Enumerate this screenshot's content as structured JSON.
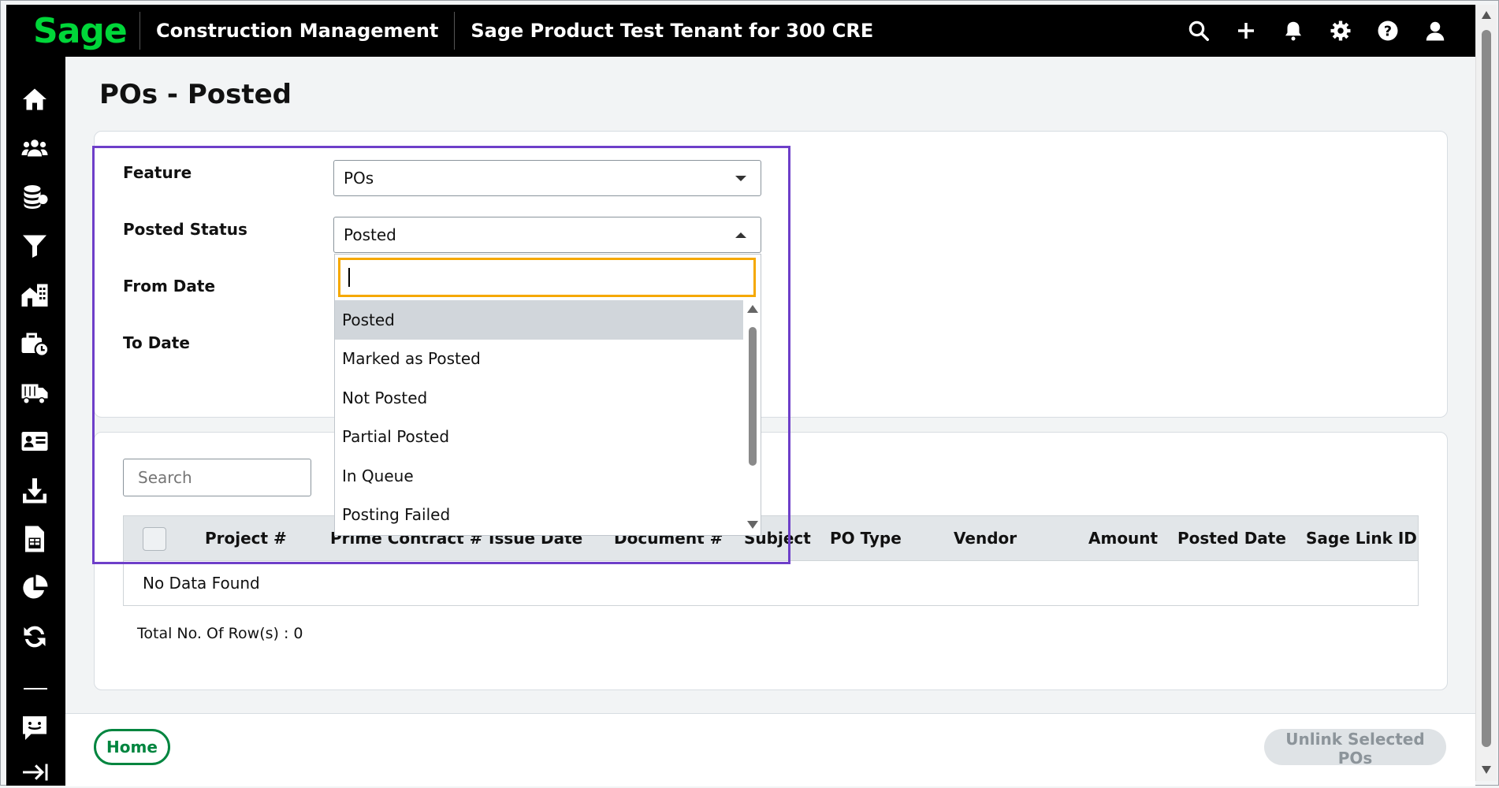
{
  "header": {
    "logo_text": "Sage",
    "app_title": "Construction Management",
    "tenant_title": "Sage Product Test Tenant for 300 CRE",
    "icons": [
      "search-icon",
      "plus-icon",
      "bell-icon",
      "gear-icon",
      "help-icon",
      "user-icon"
    ]
  },
  "sidebar": {
    "icons": [
      "home-icon",
      "people-icon",
      "database-icon",
      "filter-icon",
      "buildings-icon",
      "briefcase-clock-icon",
      "truck-icon",
      "id-card-icon",
      "download-icon",
      "spreadsheet-icon",
      "pie-chart-icon",
      "sync-icon",
      "feedback-icon",
      "expand-arrow-icon"
    ]
  },
  "page": {
    "title": "POs - Posted"
  },
  "filters": {
    "feature_label": "Feature",
    "feature_value": "POs",
    "posted_status_label": "Posted Status",
    "posted_status_value": "Posted",
    "from_date_label": "From Date",
    "to_date_label": "To Date",
    "dropdown_search_value": "",
    "dropdown_options": [
      {
        "label": "Posted",
        "selected": true
      },
      {
        "label": "Marked as Posted",
        "selected": false
      },
      {
        "label": "Not Posted",
        "selected": false
      },
      {
        "label": "Partial Posted",
        "selected": false
      },
      {
        "label": "In Queue",
        "selected": false
      },
      {
        "label": "Posting Failed",
        "selected": false
      }
    ]
  },
  "table": {
    "search_placeholder": "Search",
    "columns": [
      "Project #",
      "Prime Contract #",
      "Issue Date",
      "Document #",
      "Subject",
      "PO Type",
      "Vendor",
      "Amount",
      "Posted Date",
      "Sage Link ID"
    ],
    "empty_text": "No Data Found",
    "total_rows_text": "Total No. Of Row(s) : 0"
  },
  "footer": {
    "home_label": "Home",
    "unlink_label": "Unlink Selected POs"
  },
  "colors": {
    "brand_green": "#00d639",
    "button_green": "#00853f",
    "highlight_purple": "#6e3fc9",
    "focus_orange": "#f5a800"
  }
}
